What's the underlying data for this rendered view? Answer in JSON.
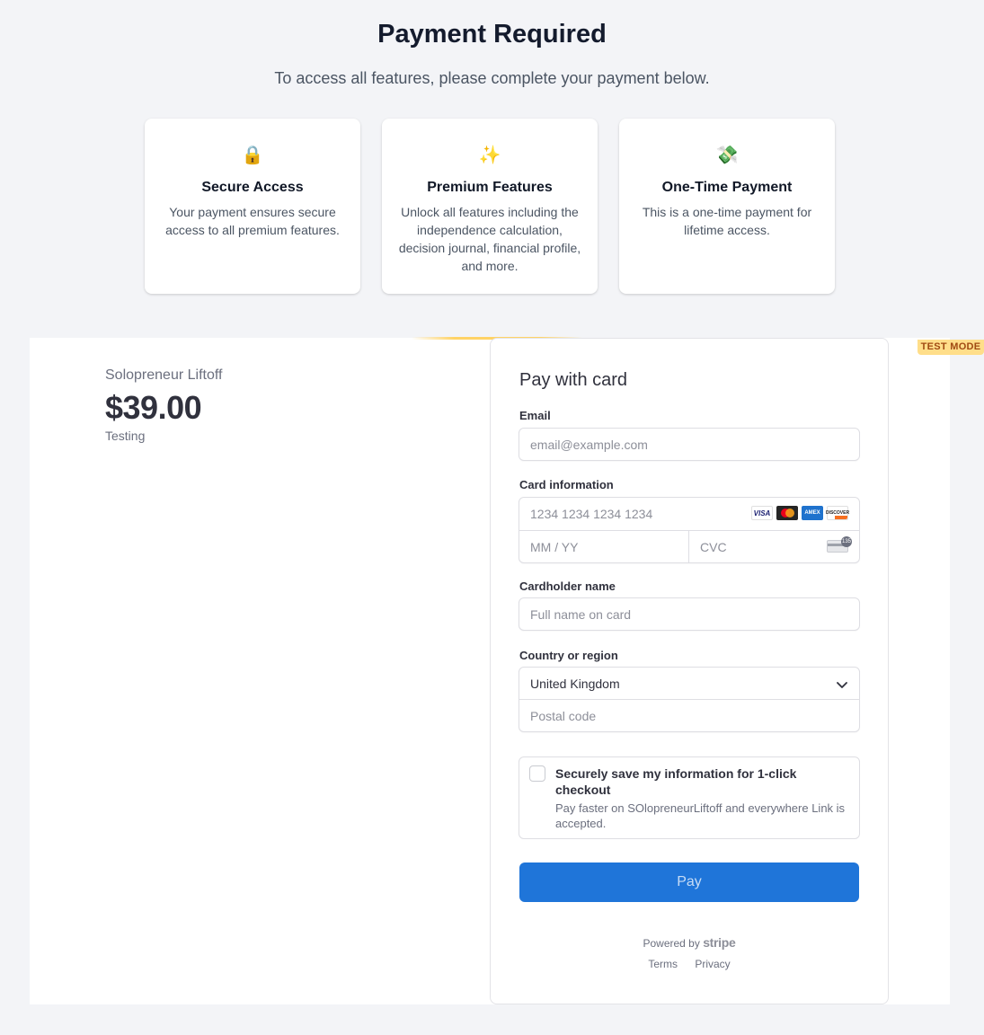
{
  "header": {
    "title": "Payment Required",
    "subtitle": "To access all features, please complete your payment below."
  },
  "features": [
    {
      "icon": "🔒",
      "icon_name": "lock-icon",
      "title": "Secure Access",
      "description": "Your payment ensures secure access to all premium features."
    },
    {
      "icon": "✨",
      "icon_name": "sparkles-icon",
      "title": "Premium Features",
      "description": "Unlock all features including the independence calculation, decision journal, financial profile, and more."
    },
    {
      "icon": "💸",
      "icon_name": "money-wings-icon",
      "title": "One-Time Payment",
      "description": "This is a one-time payment for lifetime access."
    }
  ],
  "product": {
    "name": "Solopreneur Liftoff",
    "price": "$39.00",
    "description": "Testing"
  },
  "checkout": {
    "test_mode_label": "TEST MODE",
    "title": "Pay with card",
    "email": {
      "label": "Email",
      "placeholder": "email@example.com",
      "value": ""
    },
    "card": {
      "label": "Card information",
      "number_placeholder": "1234 1234 1234 1234",
      "expiry_placeholder": "MM / YY",
      "cvc_placeholder": "CVC",
      "brands": [
        "VISA",
        "",
        "AMEX",
        "DISCOVER"
      ],
      "cvc_badge": "135"
    },
    "cardholder": {
      "label": "Cardholder name",
      "placeholder": "Full name on card",
      "value": ""
    },
    "country": {
      "label": "Country or region",
      "value": "United Kingdom",
      "postal_placeholder": "Postal code"
    },
    "save_info": {
      "title": "Securely save my information for 1-click checkout",
      "description": "Pay faster on SOlopreneurLiftoff and everywhere Link is accepted.",
      "checked": false
    },
    "pay_button_label": "Pay",
    "powered_by": "Powered by",
    "stripe_label": "stripe",
    "footer_links": [
      "Terms",
      "Privacy"
    ]
  },
  "colors": {
    "accent": "#1f75d9",
    "test_mode_bg": "#ffde8a",
    "test_mode_text": "#a04a12",
    "page_bg": "#f3f4f7"
  }
}
